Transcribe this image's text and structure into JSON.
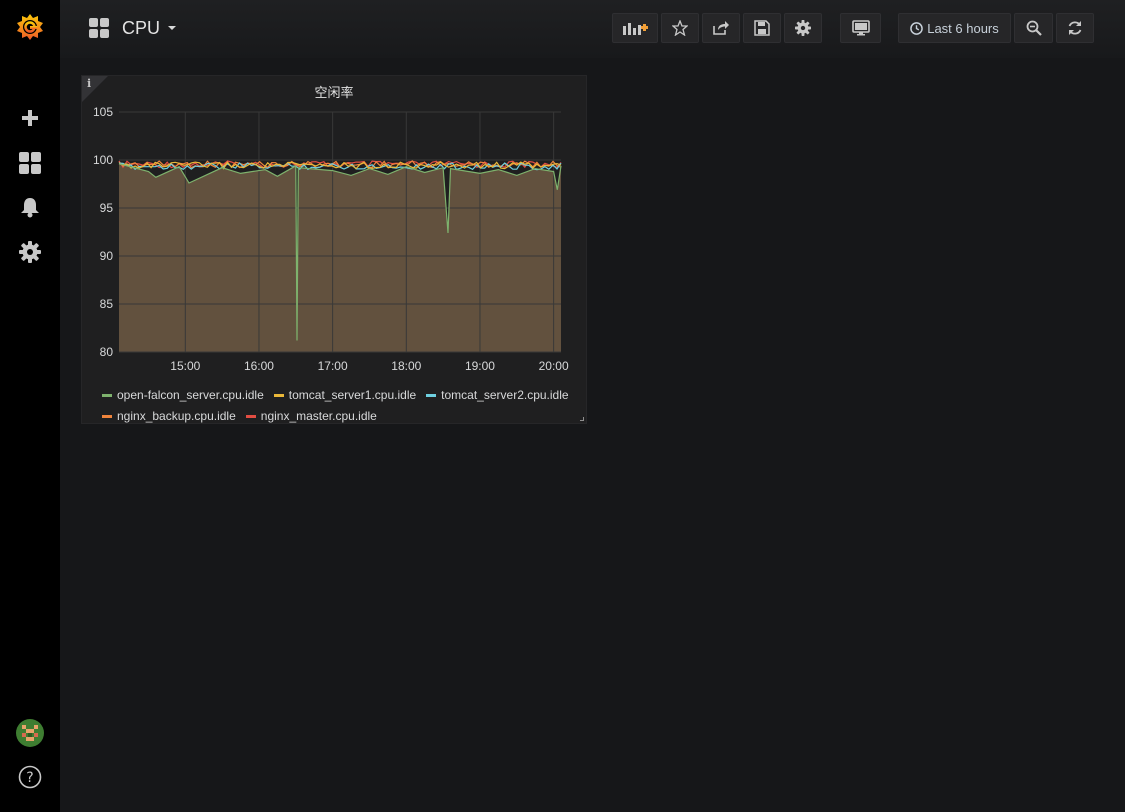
{
  "sidebar": {
    "logo": "grafana-logo",
    "items": [
      {
        "name": "create",
        "icon": "plus-icon"
      },
      {
        "name": "dashboards",
        "icon": "grid-icon"
      },
      {
        "name": "alerting",
        "icon": "bell-icon"
      },
      {
        "name": "configuration",
        "icon": "gear-icon"
      }
    ],
    "bottom": [
      {
        "name": "profile",
        "icon": "avatar"
      },
      {
        "name": "help",
        "icon": "question-icon"
      }
    ]
  },
  "header": {
    "title": "CPU",
    "actions": [
      {
        "name": "add-panel",
        "icon": "add-panel-icon"
      },
      {
        "name": "star",
        "icon": "star-icon"
      },
      {
        "name": "share",
        "icon": "share-icon"
      },
      {
        "name": "save",
        "icon": "save-icon"
      },
      {
        "name": "settings",
        "icon": "gear-icon"
      },
      {
        "name": "tv-mode",
        "icon": "monitor-icon"
      }
    ],
    "time_range": "Last 6 hours",
    "zoom_icon": "zoom-out-icon",
    "refresh_icon": "refresh-icon"
  },
  "panel": {
    "title": "空闲率",
    "info_icon": "i"
  },
  "chart_data": {
    "type": "area",
    "title": "空闲率",
    "xlabel": "",
    "ylabel": "",
    "x_ticks": [
      "15:00",
      "16:00",
      "17:00",
      "18:00",
      "19:00",
      "20:00"
    ],
    "y_ticks": [
      80,
      85,
      90,
      95,
      100,
      105
    ],
    "ylim": [
      80,
      105
    ],
    "xlim": [
      "14:06",
      "20:06"
    ],
    "grid": true,
    "legend_position": "bottom",
    "series": [
      {
        "name": "open-falcon_server.cpu.idle",
        "color": "#7eb26d",
        "points": [
          [
            "14:06",
            99.6
          ],
          [
            "14:30",
            98.8
          ],
          [
            "14:36",
            98.2
          ],
          [
            "14:55",
            99.3
          ],
          [
            "15:03",
            97.6
          ],
          [
            "15:30",
            99.2
          ],
          [
            "15:45",
            98.6
          ],
          [
            "16:05",
            99.0
          ],
          [
            "16:15",
            98.3
          ],
          [
            "16:30",
            99.4
          ],
          [
            "16:31",
            81.2
          ],
          [
            "16:32",
            99.2
          ],
          [
            "17:00",
            98.9
          ],
          [
            "17:15",
            98.4
          ],
          [
            "17:30",
            99.1
          ],
          [
            "17:45",
            98.5
          ],
          [
            "18:00",
            99.3
          ],
          [
            "18:15",
            98.7
          ],
          [
            "18:30",
            99.2
          ],
          [
            "18:34",
            92.4
          ],
          [
            "18:36",
            99.1
          ],
          [
            "19:00",
            98.6
          ],
          [
            "19:15",
            99.0
          ],
          [
            "19:30",
            98.4
          ],
          [
            "19:45",
            99.1
          ],
          [
            "20:00",
            98.8
          ],
          [
            "20:03",
            96.9
          ],
          [
            "20:06",
            99.4
          ]
        ]
      },
      {
        "name": "tomcat_server1.cpu.idle",
        "color": "#eab839",
        "points": [
          [
            "14:06",
            99.8
          ],
          [
            "20:06",
            99.8
          ]
        ]
      },
      {
        "name": "tomcat_server2.cpu.idle",
        "color": "#6ed0e0",
        "points": [
          [
            "14:06",
            99.7
          ],
          [
            "20:06",
            99.7
          ]
        ]
      },
      {
        "name": "nginx_backup.cpu.idle",
        "color": "#ef843c",
        "points": [
          [
            "14:06",
            99.9
          ],
          [
            "20:06",
            99.9
          ]
        ]
      },
      {
        "name": "nginx_master.cpu.idle",
        "color": "#e24d42",
        "points": [
          [
            "14:06",
            99.9
          ],
          [
            "20:06",
            99.9
          ]
        ]
      }
    ],
    "fill_color": "#665440",
    "colors": {
      "grid": "#383838",
      "tick_text": "#d8d9da"
    }
  }
}
